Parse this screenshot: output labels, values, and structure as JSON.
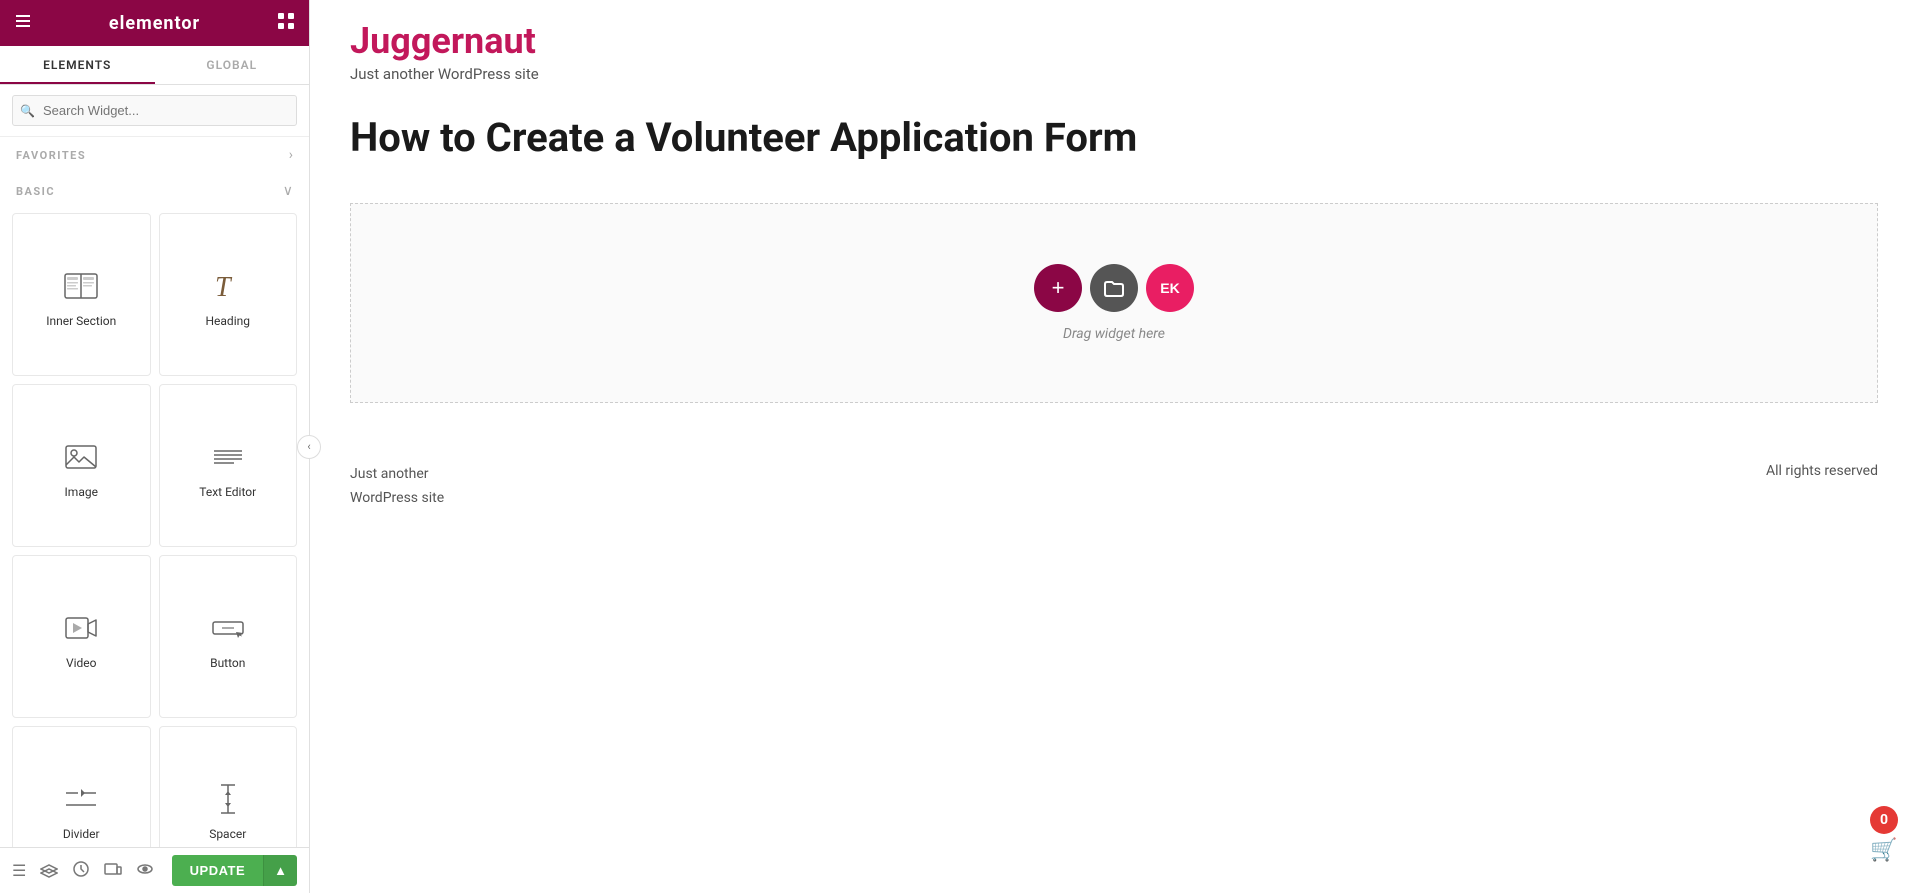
{
  "sidebar": {
    "header": {
      "logo": "elementor",
      "hamburger_icon": "≡",
      "grid_icon": "⊞"
    },
    "tabs": [
      {
        "id": "elements",
        "label": "ELEMENTS",
        "active": true
      },
      {
        "id": "global",
        "label": "GLOBAL",
        "active": false
      }
    ],
    "search": {
      "placeholder": "Search Widget..."
    },
    "sections": [
      {
        "id": "favorites",
        "label": "FAVORITES",
        "collapsed": true
      },
      {
        "id": "basic",
        "label": "BASIC",
        "collapsed": false
      }
    ],
    "widgets": [
      {
        "id": "inner-section",
        "label": "Inner Section",
        "icon": "inner-section-icon"
      },
      {
        "id": "heading",
        "label": "Heading",
        "icon": "heading-icon"
      },
      {
        "id": "image",
        "label": "Image",
        "icon": "image-icon"
      },
      {
        "id": "text-editor",
        "label": "Text Editor",
        "icon": "text-editor-icon"
      },
      {
        "id": "video",
        "label": "Video",
        "icon": "video-icon"
      },
      {
        "id": "button",
        "label": "Button",
        "icon": "button-icon"
      },
      {
        "id": "divider",
        "label": "Divider",
        "icon": "divider-icon"
      },
      {
        "id": "spacer",
        "label": "Spacer",
        "icon": "spacer-icon"
      }
    ],
    "footer": {
      "update_label": "UPDATE",
      "arrow_label": "▲"
    }
  },
  "canvas": {
    "site_title": "Juggernaut",
    "site_tagline": "Just another WordPress site",
    "post_title": "How to Create a Volunteer Application Form",
    "drop_zone": {
      "label": "Drag widget here"
    },
    "footer_tagline_line1": "Just another",
    "footer_tagline_line2": "WordPress site",
    "footer_rights": "All rights reserved"
  },
  "cart": {
    "count": "0"
  }
}
